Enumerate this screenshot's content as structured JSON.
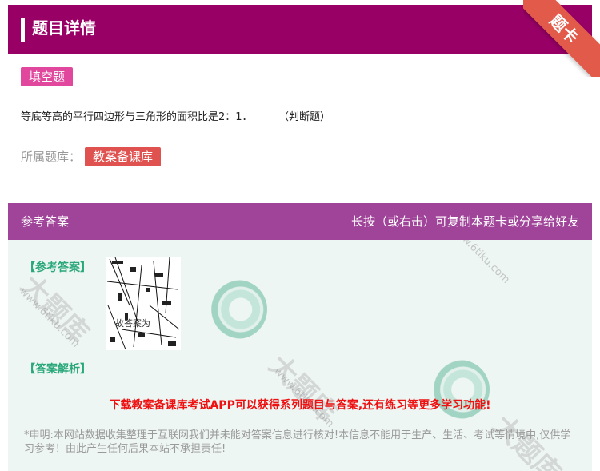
{
  "header": {
    "title": "题目详情"
  },
  "corner_ribbon": {
    "label": "题卡"
  },
  "question": {
    "type_badge": "填空题",
    "text": "等底等高的平行四边形与三角形的面积比是2：1．_____（判断题）",
    "bank_label": "所属题库：",
    "bank_name": "教案备课库"
  },
  "answer_panel": {
    "title": "参考答案",
    "hint": "长按（或右击）可复制本题卡或分享给好友",
    "answer_label": "【参考答案】",
    "answer_image_caption": "故答案为",
    "analysis_label": "【答案解析】",
    "download_notice": "下载教案备课库考试APP可以获得系列题目与答案,还有练习等更多学习功能!",
    "disclaimer": "*申明:本网站数据收集整理于互联网我们并未能对答案信息进行核对!本信息不能用于生产、生活、考试等情境中,仅供学习参考！由此产生任何后果本站不承担责任!"
  },
  "watermark": {
    "site": "www.6tiku.com",
    "brand": "大题库"
  },
  "colors": {
    "header_bg": "#990066",
    "answer_header_bg": "#a0449a",
    "type_badge_bg": "#e2479e",
    "bank_badge_bg": "#e0524f",
    "ribbon_bg": "#e25a4a",
    "section_label": "#2aa87a",
    "download_notice": "#ee1111"
  }
}
